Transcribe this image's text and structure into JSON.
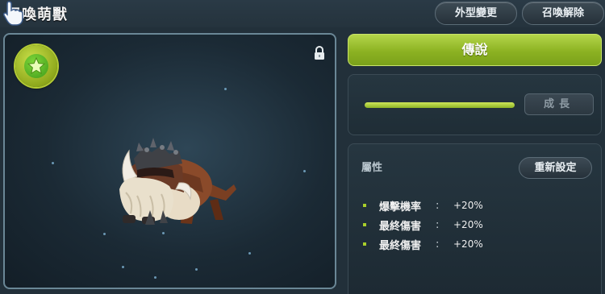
{
  "header": {
    "title": "召喚萌獸",
    "appearance_button": "外型變更",
    "dismiss_button": "召喚解除"
  },
  "pet": {
    "grade_label": "傳說",
    "grow_button": "成長",
    "growth_progress": 1.0
  },
  "attributes": {
    "title": "屬性",
    "reset_button": "重新設定",
    "stats": [
      {
        "name": "爆擊機率",
        "sep": ":",
        "value": "+20%"
      },
      {
        "name": "最終傷害",
        "sep": ":",
        "value": "+20%"
      },
      {
        "name": "最終傷害",
        "sep": ":",
        "value": "+20%"
      }
    ]
  },
  "icons": {
    "star_badge": "star-icon",
    "lock": "lock-icon",
    "cursor": "hand-cursor-icon"
  },
  "colors": {
    "accent_green": "#8cb222",
    "background": "#22303a"
  }
}
